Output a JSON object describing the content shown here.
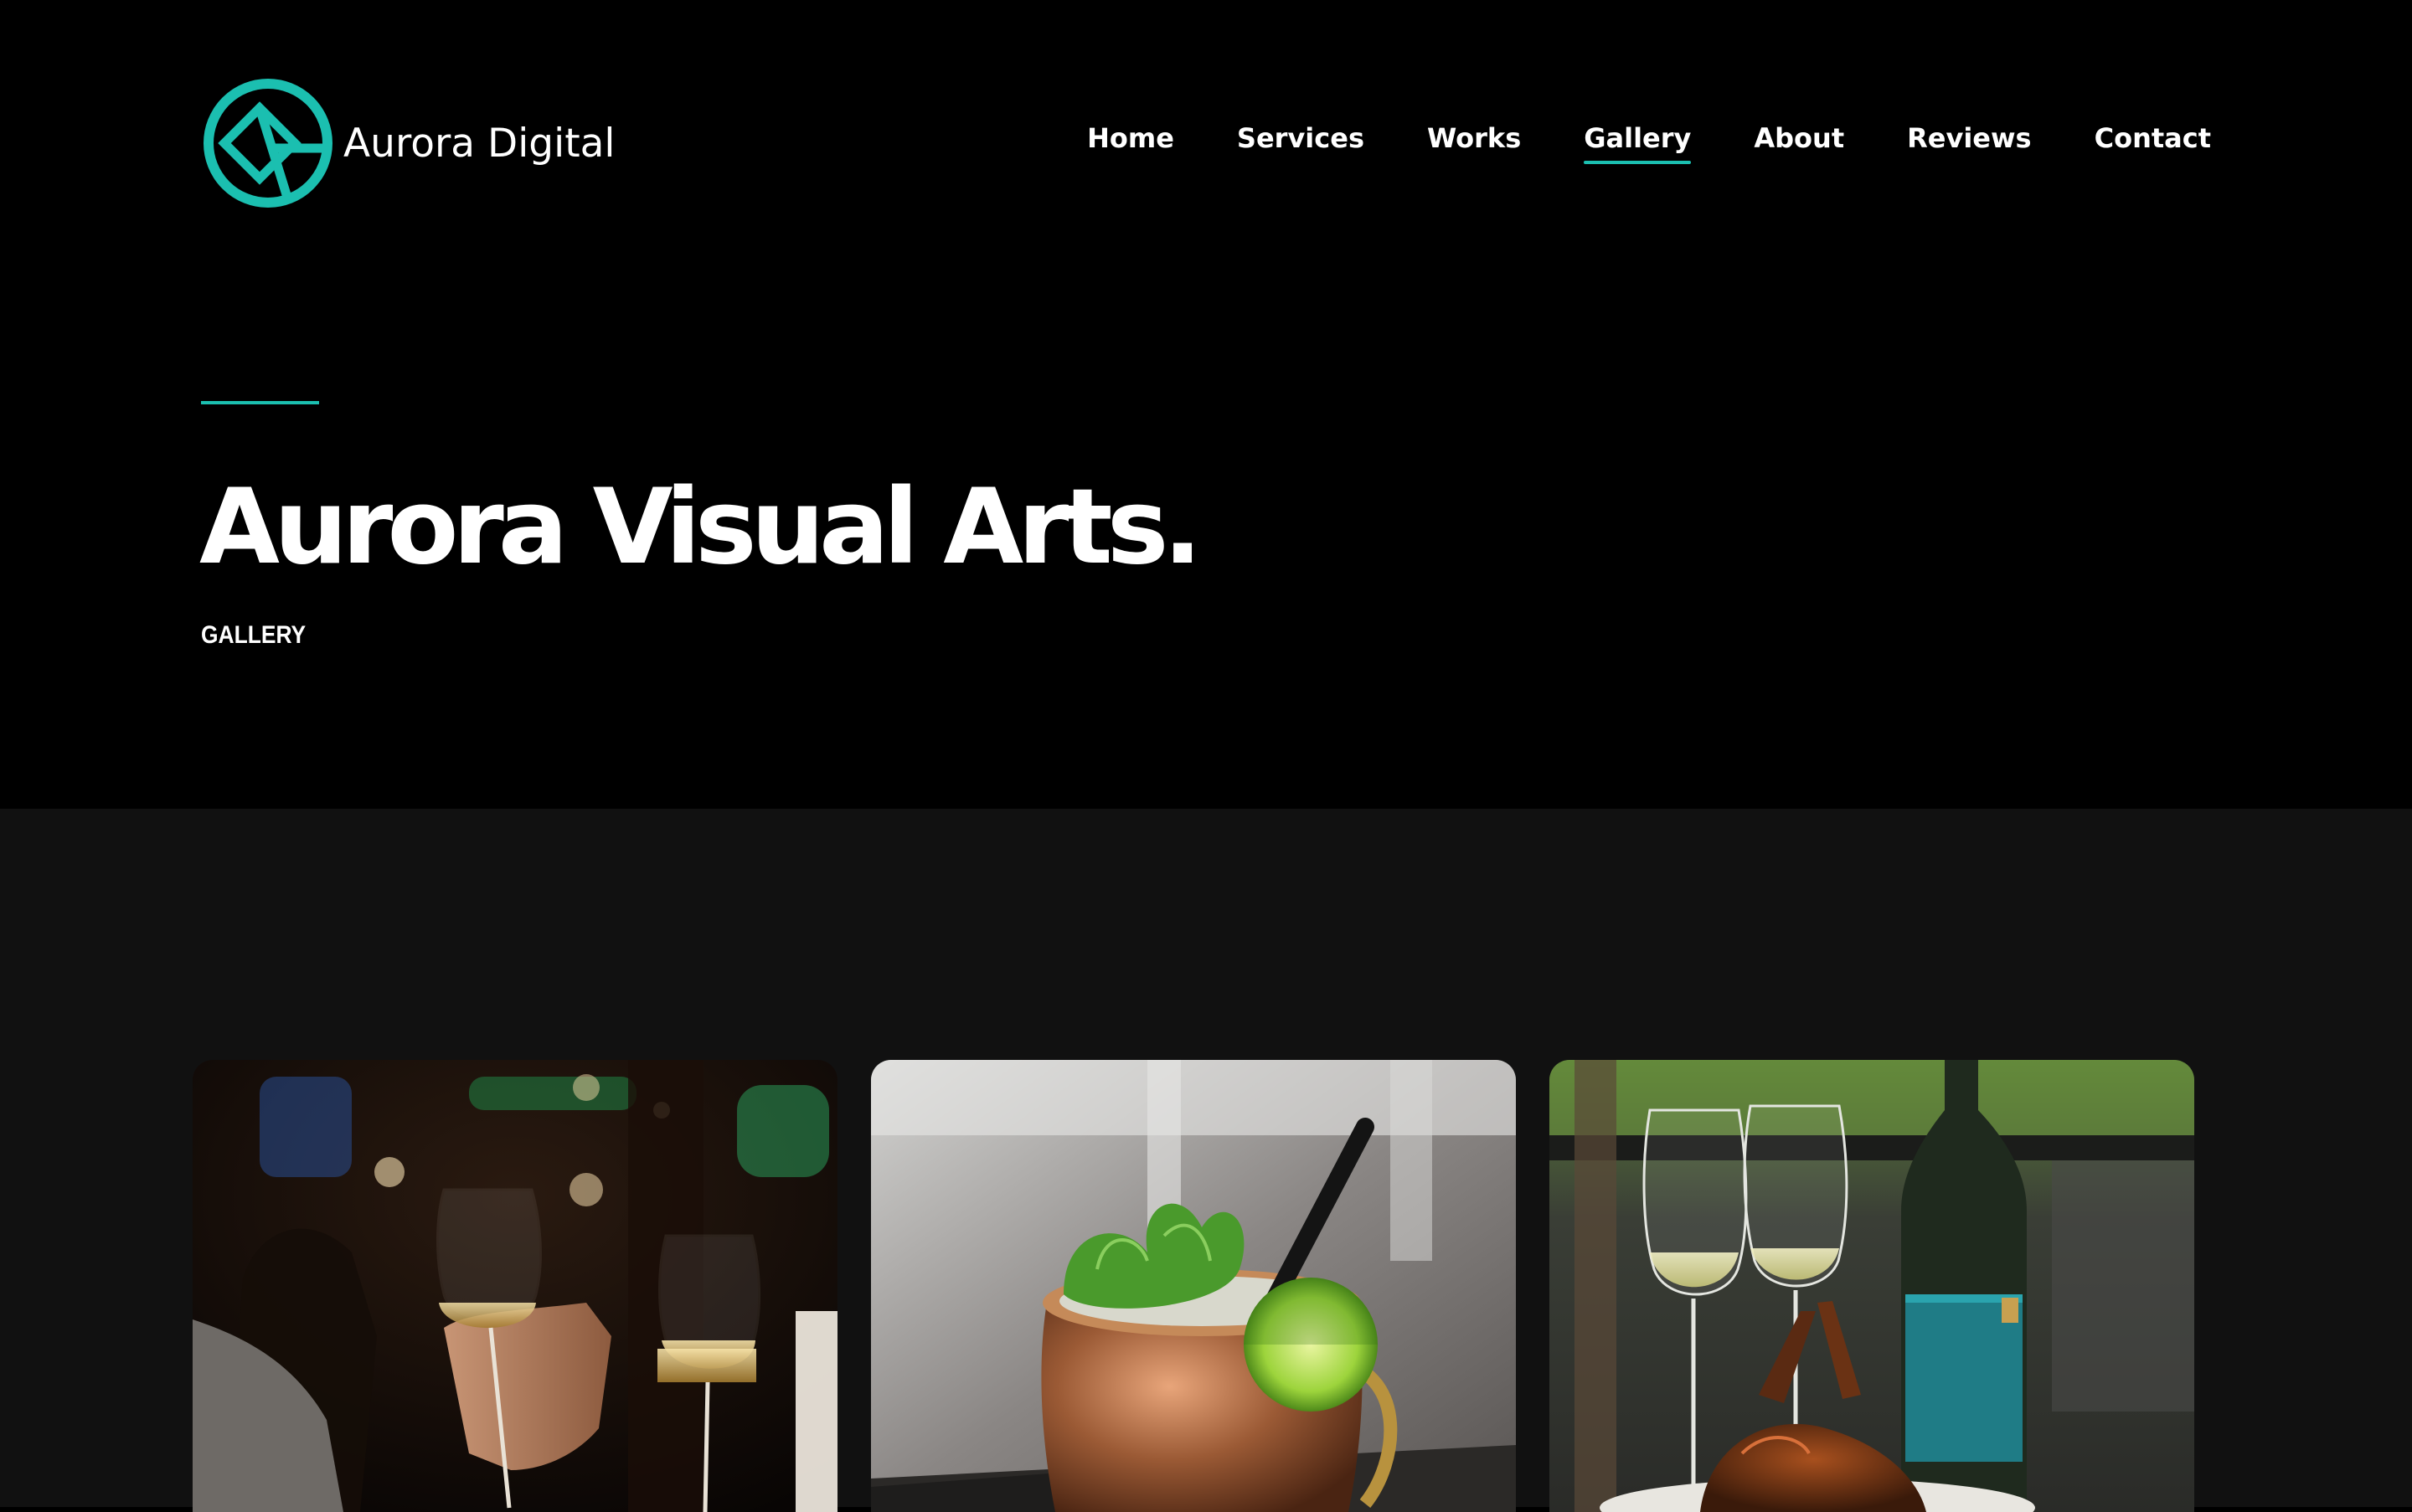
{
  "brand": {
    "name": "Aurora Digital",
    "accent_color": "#1bbfb0"
  },
  "nav": {
    "items": [
      {
        "label": "Home"
      },
      {
        "label": "Services"
      },
      {
        "label": "Works"
      },
      {
        "label": "Gallery",
        "active": true
      },
      {
        "label": "About"
      },
      {
        "label": "Reviews"
      },
      {
        "label": "Contact"
      }
    ]
  },
  "hero": {
    "title": "Aurora Visual Arts.",
    "subtitle": "GALLERY"
  },
  "gallery": {
    "items": [
      {
        "subject": "wine-glasses-photo"
      },
      {
        "subject": "moscow-mule-cocktail-photo"
      },
      {
        "subject": "wine-bottle-and-lamb-chops-photo"
      }
    ]
  }
}
